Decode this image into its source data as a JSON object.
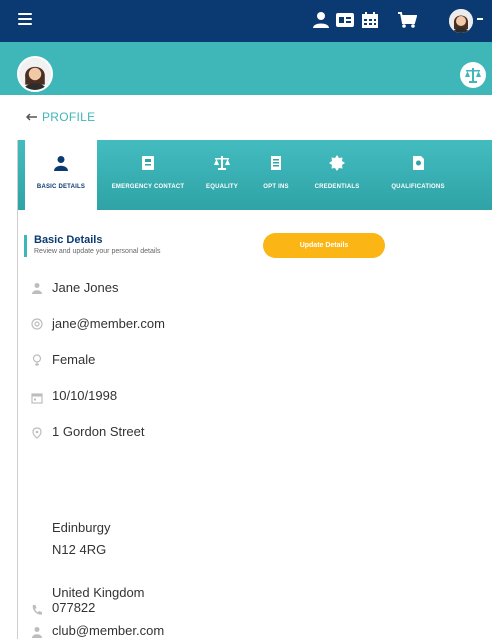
{
  "header": {
    "menu_icon": "hamburger-icon",
    "icons": [
      "user-icon",
      "id-card-icon",
      "calendar-icon",
      "cart-icon",
      "avatar-icon"
    ]
  },
  "breadcrumb": {
    "label": "PROFILE"
  },
  "tabs": [
    {
      "label": "BASIC DETAILS",
      "icon": "user-icon",
      "active": true
    },
    {
      "label": "EMERGENCY CONTACT",
      "icon": "id-card-icon",
      "active": false
    },
    {
      "label": "EQUALITY",
      "icon": "balance-scale-icon",
      "active": false
    },
    {
      "label": "OPT INS",
      "icon": "list-icon",
      "active": false
    },
    {
      "label": "CREDENTIALS",
      "icon": "badge-icon",
      "active": false
    },
    {
      "label": "QUALIFICATIONS",
      "icon": "certificate-icon",
      "active": false
    }
  ],
  "section": {
    "title": "Basic Details",
    "subtitle": "Review and update your personal details",
    "update_label": "Update Details"
  },
  "details": {
    "name": "Jane Jones",
    "email": "jane@member.com",
    "gender": "Female",
    "dob": "10/10/1998",
    "address_line1": "1 Gordon Street",
    "city": "Edinburgy",
    "postcode": "N12 4RG",
    "country": "United Kingdom",
    "phone": "077822",
    "club_email": "club@member.com"
  },
  "colors": {
    "navy": "#0b3a73",
    "teal": "#3fb7b9",
    "accent": "#fbb616"
  }
}
